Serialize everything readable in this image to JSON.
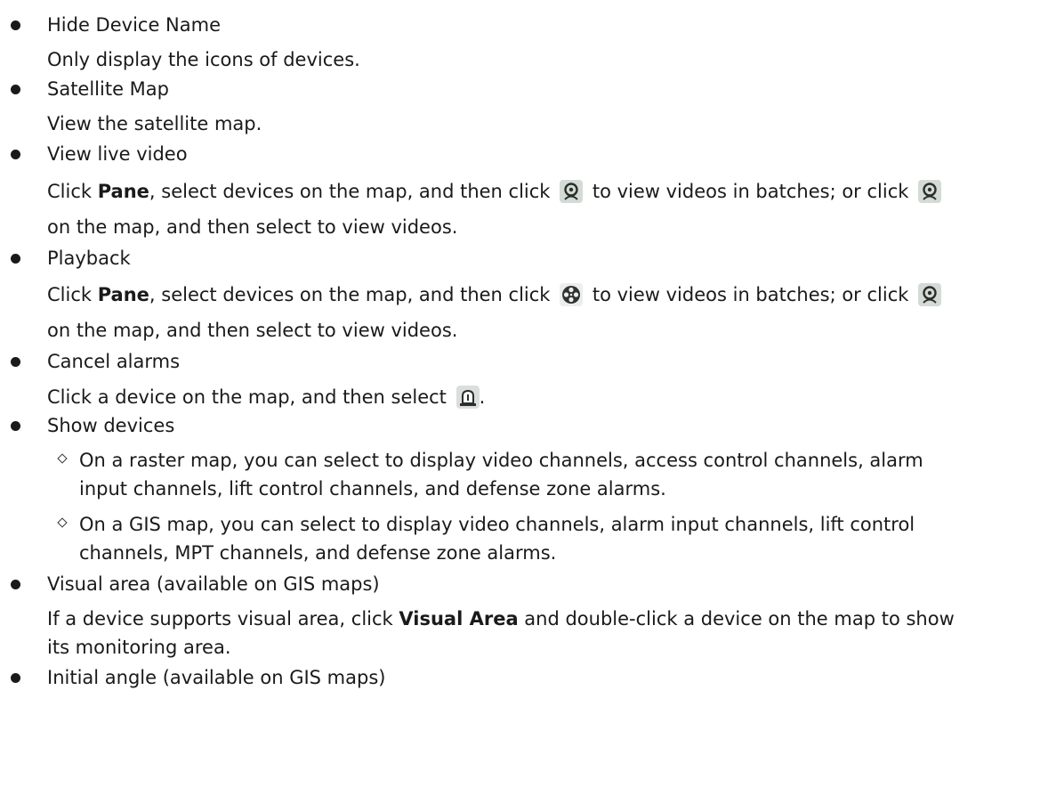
{
  "items": [
    {
      "title": "Hide Device Name",
      "desc": "Only display the icons of devices."
    },
    {
      "title": "Satellite Map",
      "desc": "View the satellite map."
    },
    {
      "title": "View live video",
      "desc_a": "Click ",
      "desc_bold": "Pane",
      "desc_b": ", select devices on the map, and then click",
      "desc_c": "to view videos in batches; or click",
      "desc_line2": "on the map, and then select to view videos."
    },
    {
      "title": "Playback",
      "desc_a": "Click ",
      "desc_bold": "Pane",
      "desc_b": ", select devices on the map, and then click",
      "desc_c": "to view videos in batches; or click",
      "desc_line2": "on the map, and then select to view videos."
    },
    {
      "title": "Cancel alarms",
      "desc_a": "Click a device on the map, and then select",
      "desc_end": "."
    },
    {
      "title": "Show devices",
      "sub": [
        {
          "line1": "On a raster map, you can select to display video channels, access control channels, alarm",
          "line2": "input channels, lift control channels, and defense zone alarms."
        },
        {
          "line1": "On a GIS map, you can select to display video channels, alarm input channels, lift control",
          "line2": "channels, MPT channels, and defense zone alarms."
        }
      ]
    },
    {
      "title": "Visual area (available on GIS maps)",
      "desc_a": "If a device supports visual area, click ",
      "desc_bold": "Visual Area",
      "desc_b": " and double-click a device on the map to show",
      "desc_line2": "its monitoring area."
    },
    {
      "title": "Initial angle (available on GIS maps)"
    }
  ],
  "icons": [
    "camera-icon",
    "film-reel-icon",
    "alarm-cancel-icon"
  ]
}
